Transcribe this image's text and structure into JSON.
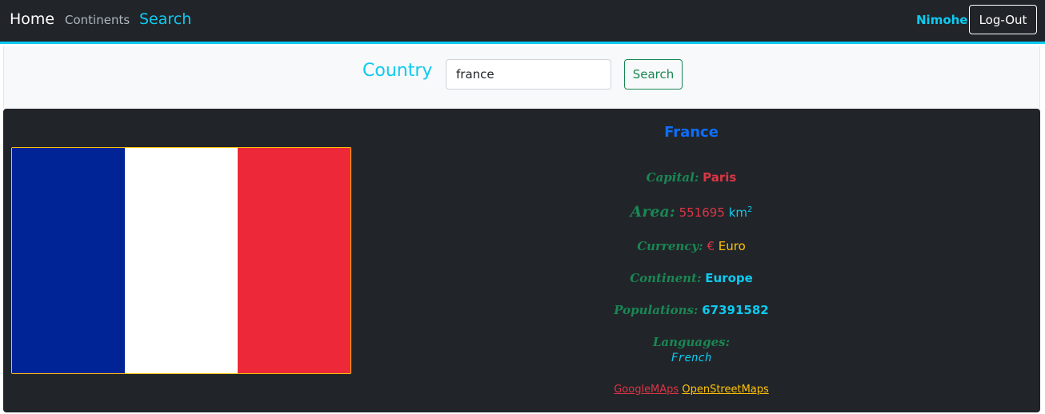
{
  "nav": {
    "home": "Home",
    "continents": "Continents",
    "search": "Search",
    "user": "Nimohe",
    "logout": "Log-Out"
  },
  "search_bar": {
    "label": "Country",
    "input_value": "france",
    "button_label": "Search"
  },
  "country": {
    "name": "France",
    "flag_colors": [
      "#002395",
      "#ffffff",
      "#ed2939"
    ],
    "capital_label": "Capital:",
    "capital": "Paris",
    "area_label": "Area:",
    "area_value": "551695",
    "area_unit": "km",
    "area_sup": "2",
    "currency_label": "Currency:",
    "currency_symbol": "€",
    "currency_name": "Euro",
    "continent_label": "Continent:",
    "continent": "Europe",
    "population_label": "Populations:",
    "population": "67391582",
    "languages_label": "Languages:",
    "languages": "French"
  },
  "links": {
    "google": "GoogleMAps",
    "osm": "OpenStreetMaps"
  },
  "colors": {
    "accent_cyan": "#0dcaf0",
    "success_green": "#198754",
    "danger_red": "#dc3545",
    "warning_yellow": "#ffc107",
    "primary_blue": "#0d6efd",
    "dark_bg": "#212529"
  }
}
